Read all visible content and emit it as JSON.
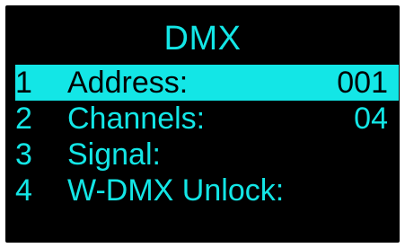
{
  "screen": {
    "title": "DMX",
    "accent_color": "#13e6e6",
    "background_color": "#000000"
  },
  "menu": {
    "items": [
      {
        "number": "1",
        "label": "Address:",
        "value": "001",
        "selected": true
      },
      {
        "number": "2",
        "label": "Channels:",
        "value": "04",
        "selected": false
      },
      {
        "number": "3",
        "label": "Signal:",
        "value": "",
        "selected": false
      },
      {
        "number": "4",
        "label": "W-DMX Unlock:",
        "value": "",
        "selected": false
      }
    ]
  }
}
